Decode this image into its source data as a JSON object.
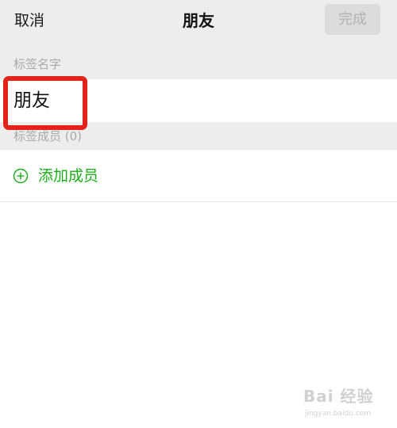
{
  "header": {
    "cancel_label": "取消",
    "title": "朋友",
    "done_label": "完成"
  },
  "tag_name_section": {
    "label": "标签名字",
    "value": "朋友"
  },
  "members_section": {
    "label": "标签成员 (0)",
    "add_member_label": "添加成员"
  },
  "icons": {
    "add": "plus-circle-icon"
  },
  "colors": {
    "accent_green": "#1aad19",
    "highlight_red": "#e2231a",
    "header_bg": "#ededed",
    "disabled_button_bg": "#dcdcdc"
  },
  "watermark": {
    "logo_text": "Bai 经验",
    "url": "jingyan.baidu.com"
  }
}
